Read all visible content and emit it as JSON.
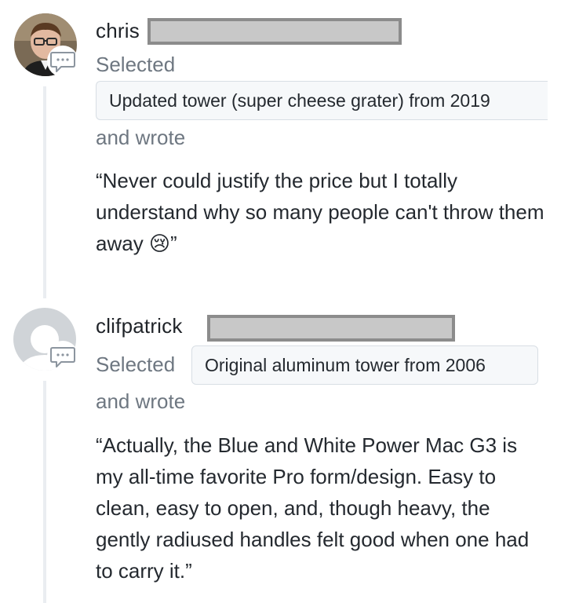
{
  "comments": [
    {
      "username": "chris",
      "selected_label": "Selected",
      "selection": "Updated tower (super cheese grater) from 2019",
      "wrote_label": "and wrote",
      "quote": "“Never could justify the price but I totally understand why so many people can't throw them away 😢”",
      "avatar": "user-photo",
      "icon": "comment-icon"
    },
    {
      "username": "clifpatrick",
      "selected_label": "Selected",
      "selection": "Original aluminum tower from 2006",
      "wrote_label": "and wrote",
      "quote": "“Actually, the Blue and White Power Mac G3 is my all-time favorite Pro form/design. Easy to clean, easy to open, and, though heavy, the gently radiused handles felt good when one had to carry it.”",
      "avatar": "default-avatar",
      "icon": "comment-icon"
    }
  ],
  "colors": {
    "text": "#24292f",
    "muted": "#6e7781",
    "chip_bg": "#f6f8fa",
    "chip_border": "#d8dee4",
    "timeline": "#eaedf1",
    "redaction": "#c8c8c8"
  }
}
